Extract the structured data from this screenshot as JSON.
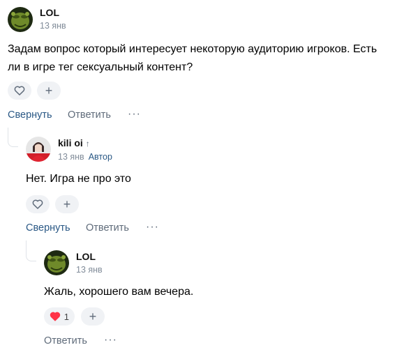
{
  "comments": [
    {
      "author": "LOL",
      "date": "13 янв",
      "text": "Задам вопрос который интересует некоторую аудиторию игроков. Есть ли в игре тег сексуальный контент?",
      "collapse_label": "Свернуть",
      "reply_label": "Ответить",
      "more_label": "···",
      "add_label": "+"
    },
    {
      "author": "kili oi",
      "author_arrow": "↑",
      "date": "13 янв",
      "badge": "Автор",
      "text": "Нет. Игра не про это",
      "collapse_label": "Свернуть",
      "reply_label": "Ответить",
      "more_label": "···",
      "add_label": "+"
    },
    {
      "author": "LOL",
      "date": "13 янв",
      "text": "Жаль, хорошего вам вечера.",
      "like_count": "1",
      "reply_label": "Ответить",
      "more_label": "···",
      "add_label": "+"
    }
  ],
  "colors": {
    "accent": "#2a5885",
    "muted": "#818c99",
    "heart_liked": "#ff3347",
    "pill_bg": "#f0f2f5"
  },
  "icons": {
    "like": "heart-outline-icon",
    "liked": "heart-filled-icon",
    "add": "plus-icon",
    "more": "more-dots-icon"
  }
}
